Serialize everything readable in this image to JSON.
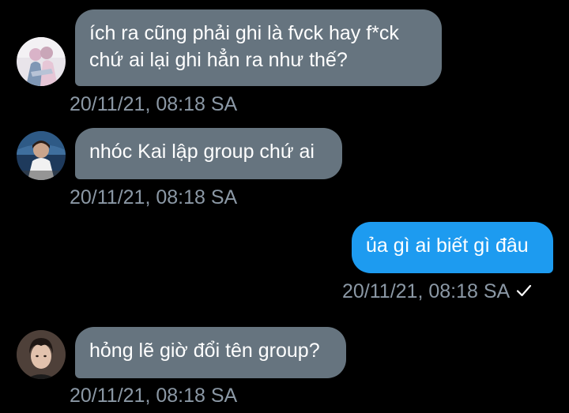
{
  "messages": [
    {
      "direction": "incoming",
      "lines": [
        "ích ra cũng phải ghi là fvck hay f*ck",
        "chứ ai lại ghi hẳn ra như thế?"
      ],
      "timestamp": "20/11/21, 08:18 SA",
      "avatar_icon": "user-avatar-icon"
    },
    {
      "direction": "incoming",
      "lines": [
        "nhóc Kai lập group chứ ai"
      ],
      "timestamp": "20/11/21, 08:18 SA",
      "avatar_icon": "user-avatar-icon"
    },
    {
      "direction": "outgoing",
      "lines": [
        "ủa gì ai biết gì đâu"
      ],
      "timestamp": "20/11/21, 08:18 SA",
      "status_icon": "checkmark-icon"
    },
    {
      "direction": "incoming",
      "lines": [
        "hỏng lẽ giờ đổi tên group?"
      ],
      "timestamp": "20/11/21, 08:18 SA",
      "avatar_icon": "user-avatar-icon"
    }
  ],
  "colors": {
    "background": "#000000",
    "incoming_bubble": "#66747f",
    "outgoing_bubble": "#1d9bf0",
    "timestamp": "#8b98a5",
    "text": "#ffffff"
  }
}
